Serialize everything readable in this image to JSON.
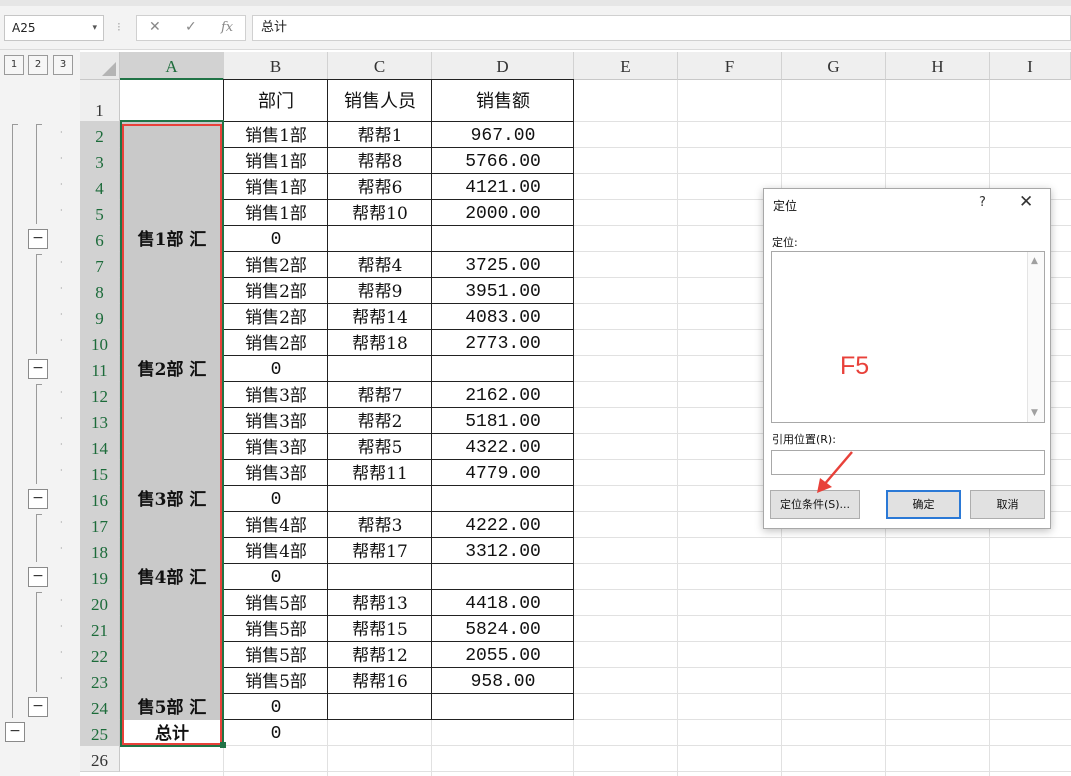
{
  "formula_bar": {
    "name_box": "A25",
    "dropdown_glyph": "▾",
    "separator": "⁝",
    "cancel_glyph": "✕",
    "enter_glyph": "✓",
    "fx_label": "fx",
    "formula": "总计"
  },
  "outline_levels": [
    "1",
    "2",
    "3"
  ],
  "collapse_glyph": "−",
  "columns": [
    "A",
    "B",
    "C",
    "D",
    "E",
    "F",
    "G",
    "H",
    "I"
  ],
  "rows": [
    "1",
    "2",
    "3",
    "4",
    "5",
    "6",
    "7",
    "8",
    "9",
    "10",
    "11",
    "12",
    "13",
    "14",
    "15",
    "16",
    "17",
    "18",
    "19",
    "20",
    "21",
    "22",
    "23",
    "24",
    "25",
    "26"
  ],
  "table": {
    "headers": [
      "部门",
      "销售人员",
      "销售额"
    ],
    "rows": [
      {
        "a": "",
        "b": "销售1部",
        "c": "帮帮1",
        "d": "967.00"
      },
      {
        "a": "",
        "b": "销售1部",
        "c": "帮帮8",
        "d": "5766.00"
      },
      {
        "a": "",
        "b": "销售1部",
        "c": "帮帮6",
        "d": "4121.00"
      },
      {
        "a": "",
        "b": "销售1部",
        "c": "帮帮10",
        "d": "2000.00"
      },
      {
        "a": "售1部 汇",
        "b": "0",
        "c": "",
        "d": ""
      },
      {
        "a": "",
        "b": "销售2部",
        "c": "帮帮4",
        "d": "3725.00"
      },
      {
        "a": "",
        "b": "销售2部",
        "c": "帮帮9",
        "d": "3951.00"
      },
      {
        "a": "",
        "b": "销售2部",
        "c": "帮帮14",
        "d": "4083.00"
      },
      {
        "a": "",
        "b": "销售2部",
        "c": "帮帮18",
        "d": "2773.00"
      },
      {
        "a": "售2部 汇",
        "b": "0",
        "c": "",
        "d": ""
      },
      {
        "a": "",
        "b": "销售3部",
        "c": "帮帮7",
        "d": "2162.00"
      },
      {
        "a": "",
        "b": "销售3部",
        "c": "帮帮2",
        "d": "5181.00"
      },
      {
        "a": "",
        "b": "销售3部",
        "c": "帮帮5",
        "d": "4322.00"
      },
      {
        "a": "",
        "b": "销售3部",
        "c": "帮帮11",
        "d": "4779.00"
      },
      {
        "a": "售3部 汇",
        "b": "0",
        "c": "",
        "d": ""
      },
      {
        "a": "",
        "b": "销售4部",
        "c": "帮帮3",
        "d": "4222.00"
      },
      {
        "a": "",
        "b": "销售4部",
        "c": "帮帮17",
        "d": "3312.00"
      },
      {
        "a": "售4部 汇",
        "b": "0",
        "c": "",
        "d": ""
      },
      {
        "a": "",
        "b": "销售5部",
        "c": "帮帮13",
        "d": "4418.00"
      },
      {
        "a": "",
        "b": "销售5部",
        "c": "帮帮15",
        "d": "5824.00"
      },
      {
        "a": "",
        "b": "销售5部",
        "c": "帮帮12",
        "d": "2055.00"
      },
      {
        "a": "",
        "b": "销售5部",
        "c": "帮帮16",
        "d": "958.00"
      },
      {
        "a": "售5部 汇",
        "b": "0",
        "c": "",
        "d": ""
      },
      {
        "a": "总计",
        "b": "0",
        "c": "",
        "d": ""
      }
    ]
  },
  "dialog": {
    "title": "定位",
    "help": "?",
    "close": "✕",
    "goto_label": "定位:",
    "annotation": "F5",
    "ref_label": "引用位置(R):",
    "ref_value": "",
    "special_button": "定位条件(S)...",
    "ok_button": "确定",
    "cancel_button": "取消",
    "scroll_up": "▲",
    "scroll_down": "▼"
  },
  "colors": {
    "selection_green": "#217346",
    "annotation_red": "#e8413a",
    "selected_gray": "#c9c9c9",
    "primary_button_border": "#2b79d6"
  }
}
